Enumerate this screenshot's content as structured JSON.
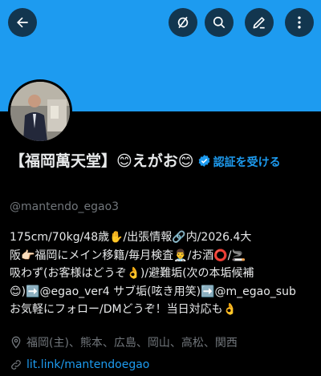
{
  "header": {
    "back_icon": "arrow-left-icon",
    "buttons": [
      "unfollow-slash-icon",
      "search-icon",
      "edit-pen-icon",
      "more-vertical-icon"
    ]
  },
  "profile": {
    "name": "【福岡萬天堂】😊えがお😊",
    "verify_label": "認証を受ける",
    "handle": "@mantendo_egao3",
    "bio_lines": [
      "175cm/70kg/48歳✋/出張情報🔗内/2026.4大",
      "阪👉🏻福岡にメイン移籍/毎月検査👨‍⚕️/お酒⭕️/🚬",
      "吸わず(お客様はどうぞ👌)/避難垢(次の本垢候補",
      "😊)➡️@egao_ver4 サブ垢(呟き用笑)➡️@m_egao_sub",
      "お気軽にフォロー/DMどうぞ！当日対応も👌"
    ],
    "location": "福岡(主)、熊本、広島、岡山、高松、関西",
    "website": "lit.link/mantendoegao"
  },
  "colors": {
    "banner": "#1d9bf0",
    "link": "#1d9bf0",
    "muted": "#71767b",
    "text": "#e7e9ea"
  }
}
